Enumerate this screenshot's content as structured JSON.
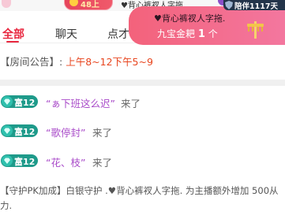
{
  "topbar": {
    "level_badge": "48上",
    "heart_text": "♥背心裤衩人字拖."
  },
  "tabs": {
    "all": "全部",
    "chat": "聊天",
    "third": "点才"
  },
  "gift_banner": {
    "title": "♥背心裤衩人字拖.",
    "gift_prefix": "九宝金耙",
    "gift_count": "1",
    "gift_unit": "个"
  },
  "companion": {
    "label": "陪伴1117天"
  },
  "notice": {
    "label": "【房间公告】:",
    "schedule": "上午8~12下午5~9"
  },
  "entries": [
    {
      "level": "富12",
      "name": "“ぁ下班这么迟”",
      "action": "来了"
    },
    {
      "level": "富12",
      "name": "“歌停封”",
      "action": "来了"
    },
    {
      "level": "富12",
      "name": "“花、枝”",
      "action": "来了"
    }
  ],
  "guard_notice": {
    "line1": "【守护PK加成】白银守护 .♥背心裤衩人字拖. 为主播额外增加 500从",
    "line2": "力."
  },
  "colors": {
    "accent": "#e8273f",
    "notice_highlight": "#e8451e",
    "username": "#a94bc9",
    "level_badge": "#1e9a8a"
  }
}
